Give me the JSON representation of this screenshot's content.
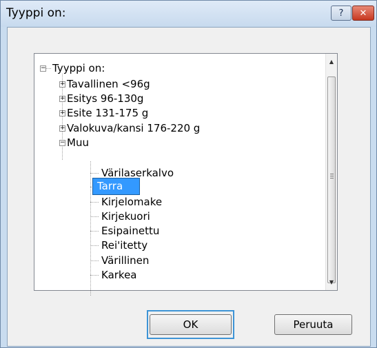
{
  "window": {
    "title": "Tyyppi on:",
    "help_glyph": "?",
    "close_glyph": "✕"
  },
  "tree": {
    "root": "Tyyppi on:",
    "items": [
      "Tavallinen <96g",
      "Esitys 96-130g",
      "Esite 131-175 g",
      "Valokuva/kansi 176-220 g",
      "Muu"
    ],
    "muu_children": [
      "Värilaserkalvo",
      "Tarra",
      "Kirjelomake",
      "Kirjekuori",
      "Esipainettu",
      "Rei'itetty",
      "Värillinen",
      "Karkea"
    ],
    "selected": "Tarra"
  },
  "buttons": {
    "ok": "OK",
    "cancel": "Peruuta"
  },
  "colors": {
    "selection": "#3399ff",
    "focus": "#3d94d6"
  }
}
